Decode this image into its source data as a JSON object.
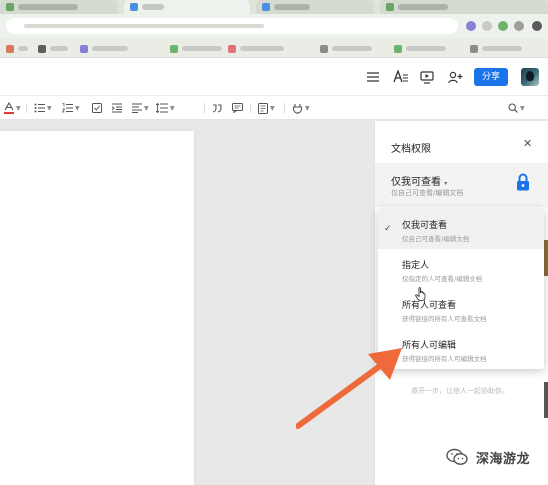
{
  "header": {
    "share_label": "分享",
    "icons": [
      "menu-icon",
      "text-format-icon",
      "present-icon",
      "add-collaborator-icon"
    ]
  },
  "toolbar": {
    "icons": [
      "font-color-icon",
      "bullet-list-icon",
      "numbered-list-icon",
      "checklist-icon",
      "indent-icon",
      "align-icon",
      "line-spacing-icon",
      "quote-icon",
      "comment-icon",
      "insert-icon",
      "plugin-icon",
      "search-icon"
    ]
  },
  "panel": {
    "title": "文档权限",
    "current": {
      "title": "仅我可查看",
      "desc": "仅自己可查看/编辑文档"
    },
    "hint": "邀开一步，让他人一起协助你。",
    "options": [
      {
        "title": "仅我可查看",
        "desc": "仅自己可查看/编辑文档",
        "selected": true
      },
      {
        "title": "指定人",
        "desc": "仅指定的人可查看/编辑文档",
        "selected": false
      },
      {
        "title": "所有人可查看",
        "desc": "获得链接的所有人可查看文档",
        "selected": false
      },
      {
        "title": "所有人可编辑",
        "desc": "获得链接的所有人可编辑文档",
        "selected": false
      }
    ]
  },
  "colors": {
    "accent": "#1a73e8",
    "arrow": "#ef6a3a",
    "lock": "#1a73e8"
  },
  "watermark": {
    "text": "深海游龙"
  }
}
